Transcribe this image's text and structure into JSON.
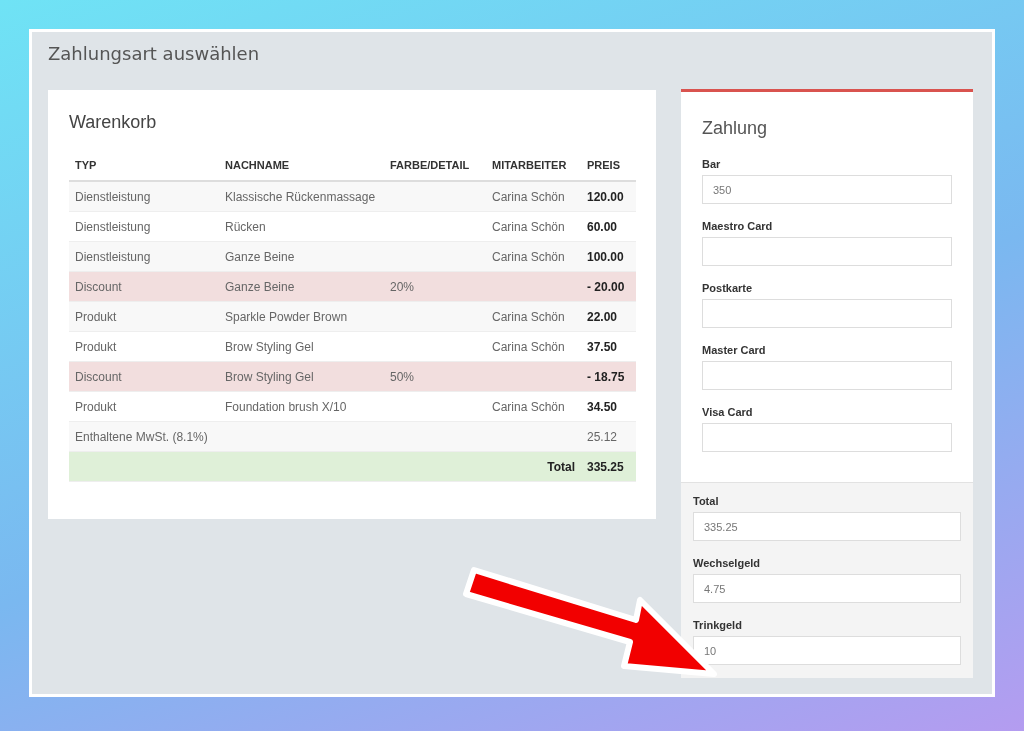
{
  "page": {
    "title": "Zahlungsart auswählen"
  },
  "cart": {
    "title": "Warenkorb",
    "columns": [
      "TYP",
      "NACHNAME",
      "FARBE/DETAIL",
      "MITARBEITER",
      "PREIS"
    ],
    "rows": [
      {
        "kind": "item",
        "type": "Dienstleistung",
        "name": "Klassische Rückenmassage",
        "employee": "Carina Schön",
        "price": "120.00"
      },
      {
        "kind": "item",
        "type": "Dienstleistung",
        "name": "Rücken",
        "employee": "Carina Schön",
        "price": "60.00"
      },
      {
        "kind": "item",
        "type": "Dienstleistung",
        "name": "Ganze Beine",
        "employee": "Carina Schön",
        "price": "100.00"
      },
      {
        "kind": "discount",
        "type": "Discount",
        "name": "Ganze Beine",
        "detail": "20%",
        "price": "- 20.00"
      },
      {
        "kind": "item",
        "type": "Produkt",
        "name": "Sparkle Powder Brown",
        "employee": "Carina Schön",
        "price": "22.00"
      },
      {
        "kind": "item",
        "type": "Produkt",
        "name": "Brow Styling Gel",
        "employee": "Carina Schön",
        "price": "37.50"
      },
      {
        "kind": "discount",
        "type": "Discount",
        "name": "Brow Styling Gel",
        "detail": "50%",
        "price": "- 18.75"
      },
      {
        "kind": "item",
        "type": "Produkt",
        "name": "Foundation brush X/10",
        "employee": "Carina Schön",
        "price": "34.50"
      },
      {
        "kind": "tax",
        "type": "Enthaltene MwSt. (8.1%)",
        "price": "25.12"
      },
      {
        "kind": "total",
        "label": "Total",
        "price": "335.25"
      }
    ]
  },
  "payment": {
    "title": "Zahlung",
    "methods": [
      {
        "label": "Bar",
        "value": "350"
      },
      {
        "label": "Maestro Card"
      },
      {
        "label": "Postkarte"
      },
      {
        "label": "Master Card"
      },
      {
        "label": "Visa Card"
      }
    ],
    "summary": [
      {
        "label": "Total",
        "value": "335.25"
      },
      {
        "label": "Wechselgeld",
        "value": "4.75"
      },
      {
        "label": "Trinkgeld",
        "value": "10"
      }
    ]
  },
  "annotations": [
    {
      "kind": "arrow"
    }
  ]
}
